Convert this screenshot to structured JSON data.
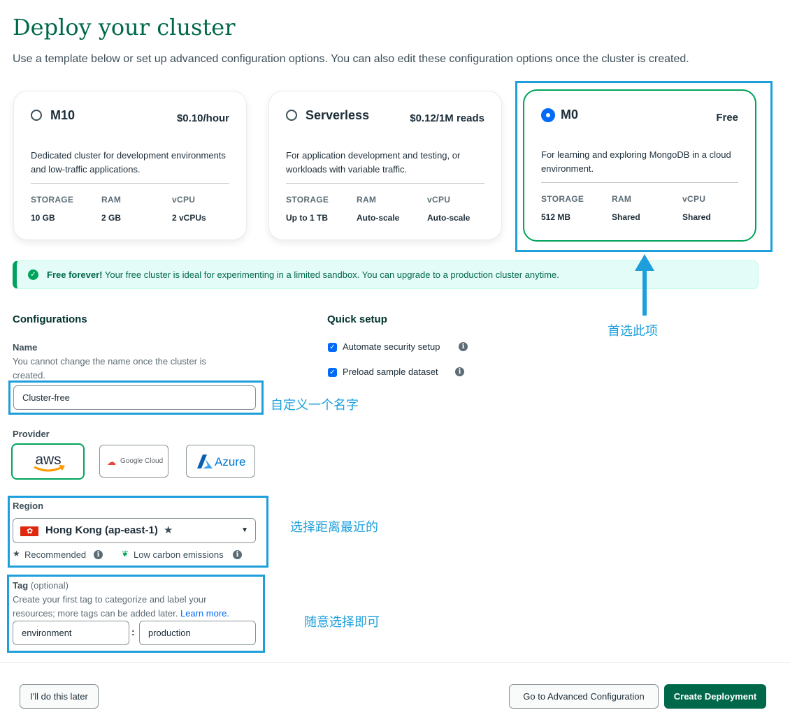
{
  "page": {
    "title": "Deploy your cluster",
    "subtitle": "Use a template below or set up advanced configuration options. You can also edit these configuration options once the cluster is created."
  },
  "cards": [
    {
      "name": "M10",
      "price": "$0.10/hour",
      "description": "Dedicated cluster for development environments and low-traffic applications.",
      "specs": [
        {
          "label": "STORAGE",
          "value": "10 GB"
        },
        {
          "label": "RAM",
          "value": "2 GB"
        },
        {
          "label": "vCPU",
          "value": "2 vCPUs"
        }
      ],
      "selected": false
    },
    {
      "name": "Serverless",
      "price": "$0.12/1M reads",
      "description": "For application development and testing, or workloads with variable traffic.",
      "specs": [
        {
          "label": "STORAGE",
          "value": "Up to 1 TB"
        },
        {
          "label": "RAM",
          "value": "Auto-scale"
        },
        {
          "label": "vCPU",
          "value": "Auto-scale"
        }
      ],
      "selected": false
    },
    {
      "name": "M0",
      "price": "Free",
      "description": "For learning and exploring MongoDB in a cloud environment.",
      "specs": [
        {
          "label": "STORAGE",
          "value": "512 MB"
        },
        {
          "label": "RAM",
          "value": "Shared"
        },
        {
          "label": "vCPU",
          "value": "Shared"
        }
      ],
      "selected": true
    }
  ],
  "banner": {
    "strong": "Free forever!",
    "text": " Your free cluster is ideal for experimenting in a limited sandbox. You can upgrade to a production cluster anytime."
  },
  "configurations": {
    "heading": "Configurations",
    "name_label": "Name",
    "name_help": "You cannot change the name once the cluster is created.",
    "name_value": "Cluster-free",
    "provider_label": "Provider",
    "providers": [
      "aws",
      "Google Cloud",
      "Azure"
    ],
    "region_label": "Region",
    "region_value": "Hong Kong (ap-east-1)",
    "recommended": "Recommended",
    "low_carbon": "Low carbon emissions",
    "tag_label": "Tag",
    "tag_optional": "(optional)",
    "tag_help": "Create your first tag to categorize and label your resources; more tags can be added later.",
    "tag_learn_more": "Learn more.",
    "tag_key": "environment",
    "tag_separator": ":",
    "tag_value": "production"
  },
  "quick_setup": {
    "heading": "Quick setup",
    "options": [
      {
        "label": "Automate security setup",
        "checked": true
      },
      {
        "label": "Preload sample dataset",
        "checked": true
      }
    ]
  },
  "annotations": {
    "preferred": "首选此项",
    "custom_name": "自定义一个名字",
    "nearest": "选择距离最近的",
    "any": "随意选择即可",
    "highlight_color": "#1e9fdc"
  },
  "footer": {
    "later": "I'll do this later",
    "advanced": "Go to Advanced Configuration",
    "create": "Create Deployment"
  },
  "colors": {
    "brand_green": "#00684a",
    "accent_green": "#00a35c",
    "blue": "#016bf8"
  }
}
